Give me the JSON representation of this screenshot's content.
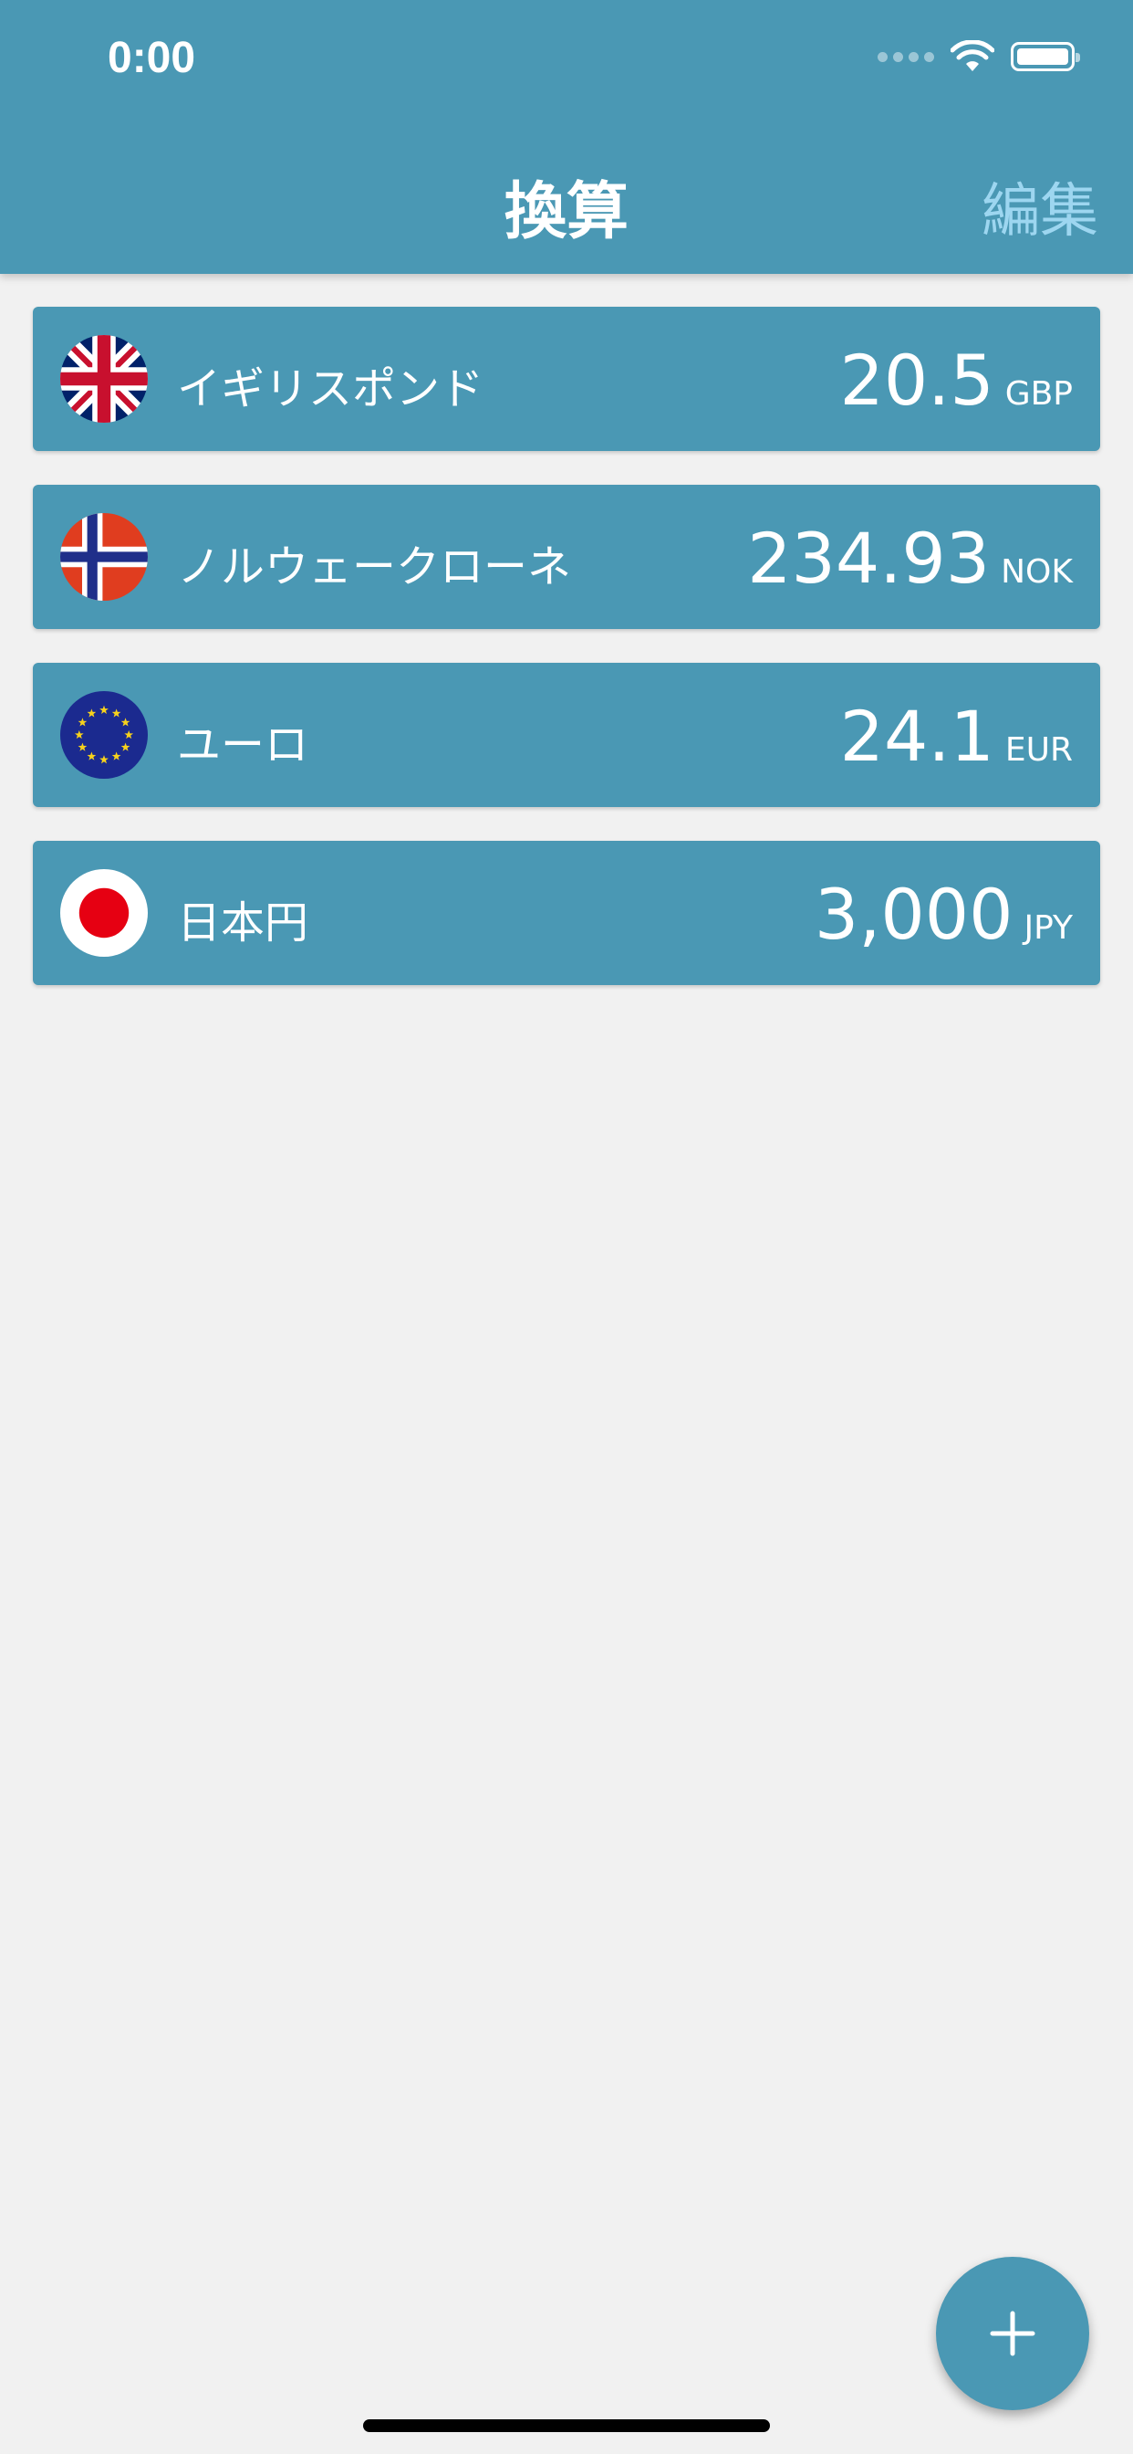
{
  "status_bar": {
    "time": "0:00"
  },
  "nav": {
    "title": "換算",
    "edit_label": "編集"
  },
  "currencies": [
    {
      "name": "イギリスポンド",
      "amount": "20.5",
      "code": "GBP",
      "flag_icon": "uk-flag-icon"
    },
    {
      "name": "ノルウェークローネ",
      "amount": "234.93",
      "code": "NOK",
      "flag_icon": "norway-flag-icon"
    },
    {
      "name": "ユーロ",
      "amount": "24.1",
      "code": "EUR",
      "flag_icon": "eu-flag-icon"
    },
    {
      "name": "日本円",
      "amount": "3,000",
      "code": "JPY",
      "flag_icon": "japan-flag-icon"
    }
  ],
  "colors": {
    "primary": "#4a98b4",
    "edit_text": "#9dd6f0",
    "background": "#f1f1f1"
  }
}
